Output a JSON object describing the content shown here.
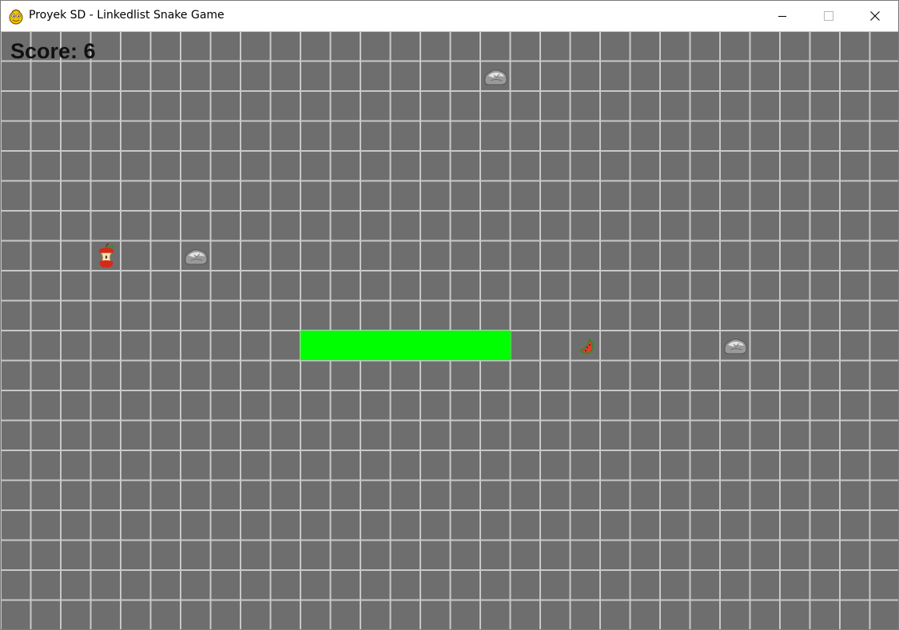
{
  "window": {
    "title": "Proyek SD - Linkedlist Snake Game",
    "icon": "pygame-snake-icon",
    "controls": [
      "minimize-icon",
      "maximize-icon",
      "close-icon"
    ]
  },
  "game": {
    "score_text": "Score: 6",
    "colors": {
      "background": "#6e6e6e",
      "grid_line": "#c8c8c8",
      "snake": "#00ff00"
    },
    "grid": {
      "columns": 30,
      "rows": 20
    },
    "snake": [
      {
        "col": 10,
        "row": 10
      },
      {
        "col": 11,
        "row": 10
      },
      {
        "col": 12,
        "row": 10
      },
      {
        "col": 13,
        "row": 10
      },
      {
        "col": 14,
        "row": 10
      },
      {
        "col": 15,
        "row": 10
      },
      {
        "col": 16,
        "row": 10
      }
    ],
    "items": [
      {
        "type": "rock",
        "icon": "rock-icon",
        "col": 16,
        "row": 1
      },
      {
        "type": "apple-core",
        "icon": "apple-core-icon",
        "col": 3,
        "row": 7
      },
      {
        "type": "rock",
        "icon": "rock-icon",
        "col": 6,
        "row": 7
      },
      {
        "type": "watermelon",
        "icon": "watermelon-slice-icon",
        "col": 19,
        "row": 10
      },
      {
        "type": "rock",
        "icon": "rock-icon",
        "col": 24,
        "row": 10
      }
    ]
  }
}
